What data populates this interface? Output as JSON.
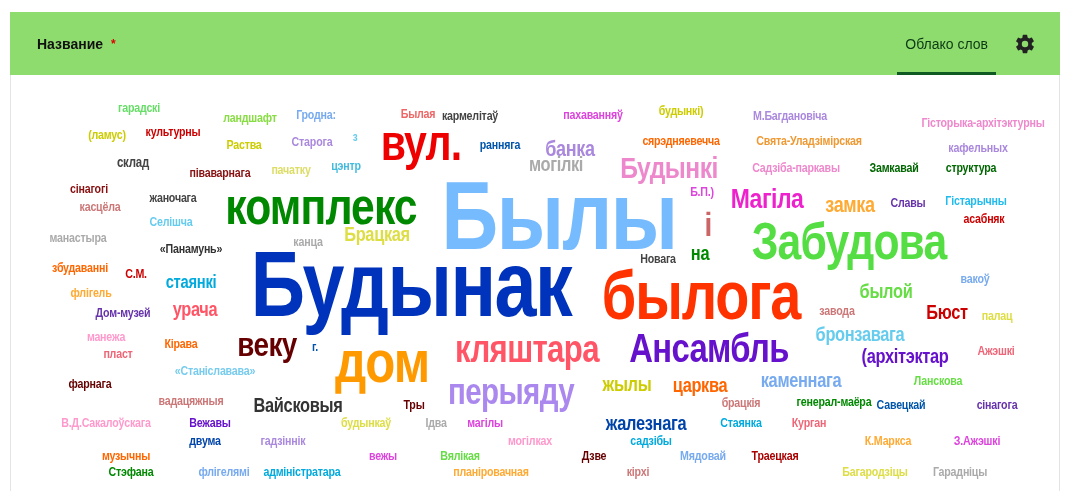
{
  "header": {
    "title": "Название",
    "required_mark": "*"
  },
  "tabs": [
    {
      "label": "Облако слов",
      "selected": true
    }
  ],
  "words": [
    {
      "text": "гарадскі",
      "color": "#66dd66"
    },
    {
      "text": "ландшафт",
      "color": "#88dd44"
    },
    {
      "text": "Гродна:",
      "color": "#77aaee"
    },
    {
      "text": "Былая",
      "color": "#ee6666"
    },
    {
      "text": "кармелітаў",
      "color": "#444444"
    },
    {
      "text": "пахаванняў",
      "color": "#dd44dd"
    },
    {
      "text": "будынкі)",
      "color": "#cccc00"
    },
    {
      "text": "М.Багдановіча",
      "color": "#aa88dd"
    },
    {
      "text": "Гісторыка-архітэктурны",
      "color": "#ee88cc"
    },
    {
      "text": "(ламус)",
      "color": "#cccc00"
    },
    {
      "text": "культурны",
      "color": "#cc0000"
    },
    {
      "text": "Раства",
      "color": "#cccc00"
    },
    {
      "text": "Старога",
      "color": "#aa88dd"
    },
    {
      "text": "з",
      "color": "#66ccee"
    },
    {
      "text": "вул.",
      "color": "#ee0000"
    },
    {
      "text": "ранняга",
      "color": "#0055aa"
    },
    {
      "text": "банка",
      "color": "#aa88dd"
    },
    {
      "text": "сярэдняевечча",
      "color": "#ff6600"
    },
    {
      "text": "Свята-Уладзімірская",
      "color": "#ee9933"
    },
    {
      "text": "кафельных",
      "color": "#aa88dd"
    },
    {
      "text": "склад",
      "color": "#444444"
    },
    {
      "text": "піваварнага",
      "color": "#881111"
    },
    {
      "text": "пачатку",
      "color": "#dddd66"
    },
    {
      "text": "цэнтр",
      "color": "#44bbdd"
    },
    {
      "text": "могілкі",
      "color": "#aaaaaa"
    },
    {
      "text": "Будынкі",
      "color": "#ee88cc"
    },
    {
      "text": "Садзіба-паркавы",
      "color": "#ee88cc"
    },
    {
      "text": "Замкавай",
      "color": "#006600"
    },
    {
      "text": "структура",
      "color": "#006600"
    },
    {
      "text": "сінагогі",
      "color": "#881111"
    },
    {
      "text": "жаночага",
      "color": "#444444"
    },
    {
      "text": "комплекс",
      "color": "#008800"
    },
    {
      "text": "Былы",
      "color": "#77bbff"
    },
    {
      "text": "Б.П.)",
      "color": "#dd44dd"
    },
    {
      "text": "Магіла",
      "color": "#ee22cc"
    },
    {
      "text": "замка",
      "color": "#ffaa33"
    },
    {
      "text": "Славы",
      "color": "#6633aa"
    },
    {
      "text": "Гістарычны",
      "color": "#22bbee"
    },
    {
      "text": "касцёла",
      "color": "#cc7777"
    },
    {
      "text": "Селішча",
      "color": "#66ccee"
    },
    {
      "text": "і",
      "color": "#cc6666"
    },
    {
      "text": "асабняк",
      "color": "#cc0000"
    },
    {
      "text": "манастыра",
      "color": "#aaaaaa"
    },
    {
      "text": "канца",
      "color": "#aaaaaa"
    },
    {
      "text": "Брацкая",
      "color": "#dddd44"
    },
    {
      "text": "«Панамунь»",
      "color": "#333333"
    },
    {
      "text": "на",
      "color": "#008800"
    },
    {
      "text": "Забудова",
      "color": "#55dd44"
    },
    {
      "text": "Будынак",
      "color": "#0033bb"
    },
    {
      "text": "Новага",
      "color": "#444444"
    },
    {
      "text": "збудаванні",
      "color": "#ff6600"
    },
    {
      "text": "С.М.",
      "color": "#cc0000"
    },
    {
      "text": "стаянкі",
      "color": "#00aadd"
    },
    {
      "text": "былога",
      "color": "#ff3300"
    },
    {
      "text": "вакоў",
      "color": "#77aaee"
    },
    {
      "text": "флігель",
      "color": "#ffaa33"
    },
    {
      "text": "былой",
      "color": "#66dd44"
    },
    {
      "text": "Дом-музей",
      "color": "#6633aa"
    },
    {
      "text": "урача",
      "color": "#ff5566"
    },
    {
      "text": "завода",
      "color": "#cc7777"
    },
    {
      "text": "Бюст",
      "color": "#cc0000"
    },
    {
      "text": "палац",
      "color": "#dddd44"
    },
    {
      "text": "манежа",
      "color": "#ff99cc"
    },
    {
      "text": "пласт",
      "color": "#ee6677"
    },
    {
      "text": "Кірава",
      "color": "#ff6600"
    },
    {
      "text": "веку",
      "color": "#660000"
    },
    {
      "text": "г.",
      "color": "#0055aa"
    },
    {
      "text": "«Станіслававa»",
      "color": "#77ccee"
    },
    {
      "text": "фарнага",
      "color": "#660000"
    },
    {
      "text": "вадацяжныя",
      "color": "#cc7777"
    },
    {
      "text": "Вайсковыя",
      "color": "#333333"
    },
    {
      "text": "дом",
      "color": "#ff9900"
    },
    {
      "text": "кляштара",
      "color": "#ff5566"
    },
    {
      "text": "Ансамбль",
      "color": "#6611cc"
    },
    {
      "text": "бронзавага",
      "color": "#66ccee"
    },
    {
      "text": "(архітэктар",
      "color": "#6611cc"
    },
    {
      "text": "Ажэшкі",
      "color": "#ee6677"
    },
    {
      "text": "Тры",
      "color": "#660000"
    },
    {
      "text": "перыяду",
      "color": "#aa88ee"
    },
    {
      "text": "жылы",
      "color": "#cccc00"
    },
    {
      "text": "царква",
      "color": "#ff6600"
    },
    {
      "text": "каменнага",
      "color": "#77aaee"
    },
    {
      "text": "Ланскова",
      "color": "#66dd44"
    },
    {
      "text": "брацкія",
      "color": "#cc7777"
    },
    {
      "text": "генерал-маёра",
      "color": "#008800"
    },
    {
      "text": "Савецкай",
      "color": "#0055aa"
    },
    {
      "text": "сінагога",
      "color": "#6633aa"
    },
    {
      "text": "В.Д.Сакалоўскага",
      "color": "#ff99cc"
    },
    {
      "text": "Вежавы",
      "color": "#6611cc"
    },
    {
      "text": "будынкаў",
      "color": "#dddd44"
    },
    {
      "text": "Ідва",
      "color": "#aaaaaa"
    },
    {
      "text": "магілы",
      "color": "#dd44dd"
    },
    {
      "text": "жалезнага",
      "color": "#0044aa"
    },
    {
      "text": "Стаянка",
      "color": "#00aadd"
    },
    {
      "text": "Курган",
      "color": "#ee6677"
    },
    {
      "text": "двума",
      "color": "#0044aa"
    },
    {
      "text": "гадзіннік",
      "color": "#aa88dd"
    },
    {
      "text": "могілках",
      "color": "#ff99cc"
    },
    {
      "text": "садзібы",
      "color": "#00aadd"
    },
    {
      "text": "К.Маркса",
      "color": "#ffaa33"
    },
    {
      "text": "З.Ажэшкі",
      "color": "#dd44dd"
    },
    {
      "text": "музычны",
      "color": "#ff6600"
    },
    {
      "text": "вежы",
      "color": "#dd44dd"
    },
    {
      "text": "Вялікая",
      "color": "#66dd44"
    },
    {
      "text": "Дзве",
      "color": "#660000"
    },
    {
      "text": "Мядовай",
      "color": "#77aaee"
    },
    {
      "text": "Траецкая",
      "color": "#aa0000"
    },
    {
      "text": "Стэфана",
      "color": "#008800"
    },
    {
      "text": "флігелямі",
      "color": "#77aaee"
    },
    {
      "text": "адміністратара",
      "color": "#00aadd"
    },
    {
      "text": "планіровачная",
      "color": "#ffaa33"
    },
    {
      "text": "кірхі",
      "color": "#cc7777"
    },
    {
      "text": "Багародзіцы",
      "color": "#dddd44"
    },
    {
      "text": "Гарадніцы",
      "color": "#aaaaaa"
    }
  ]
}
